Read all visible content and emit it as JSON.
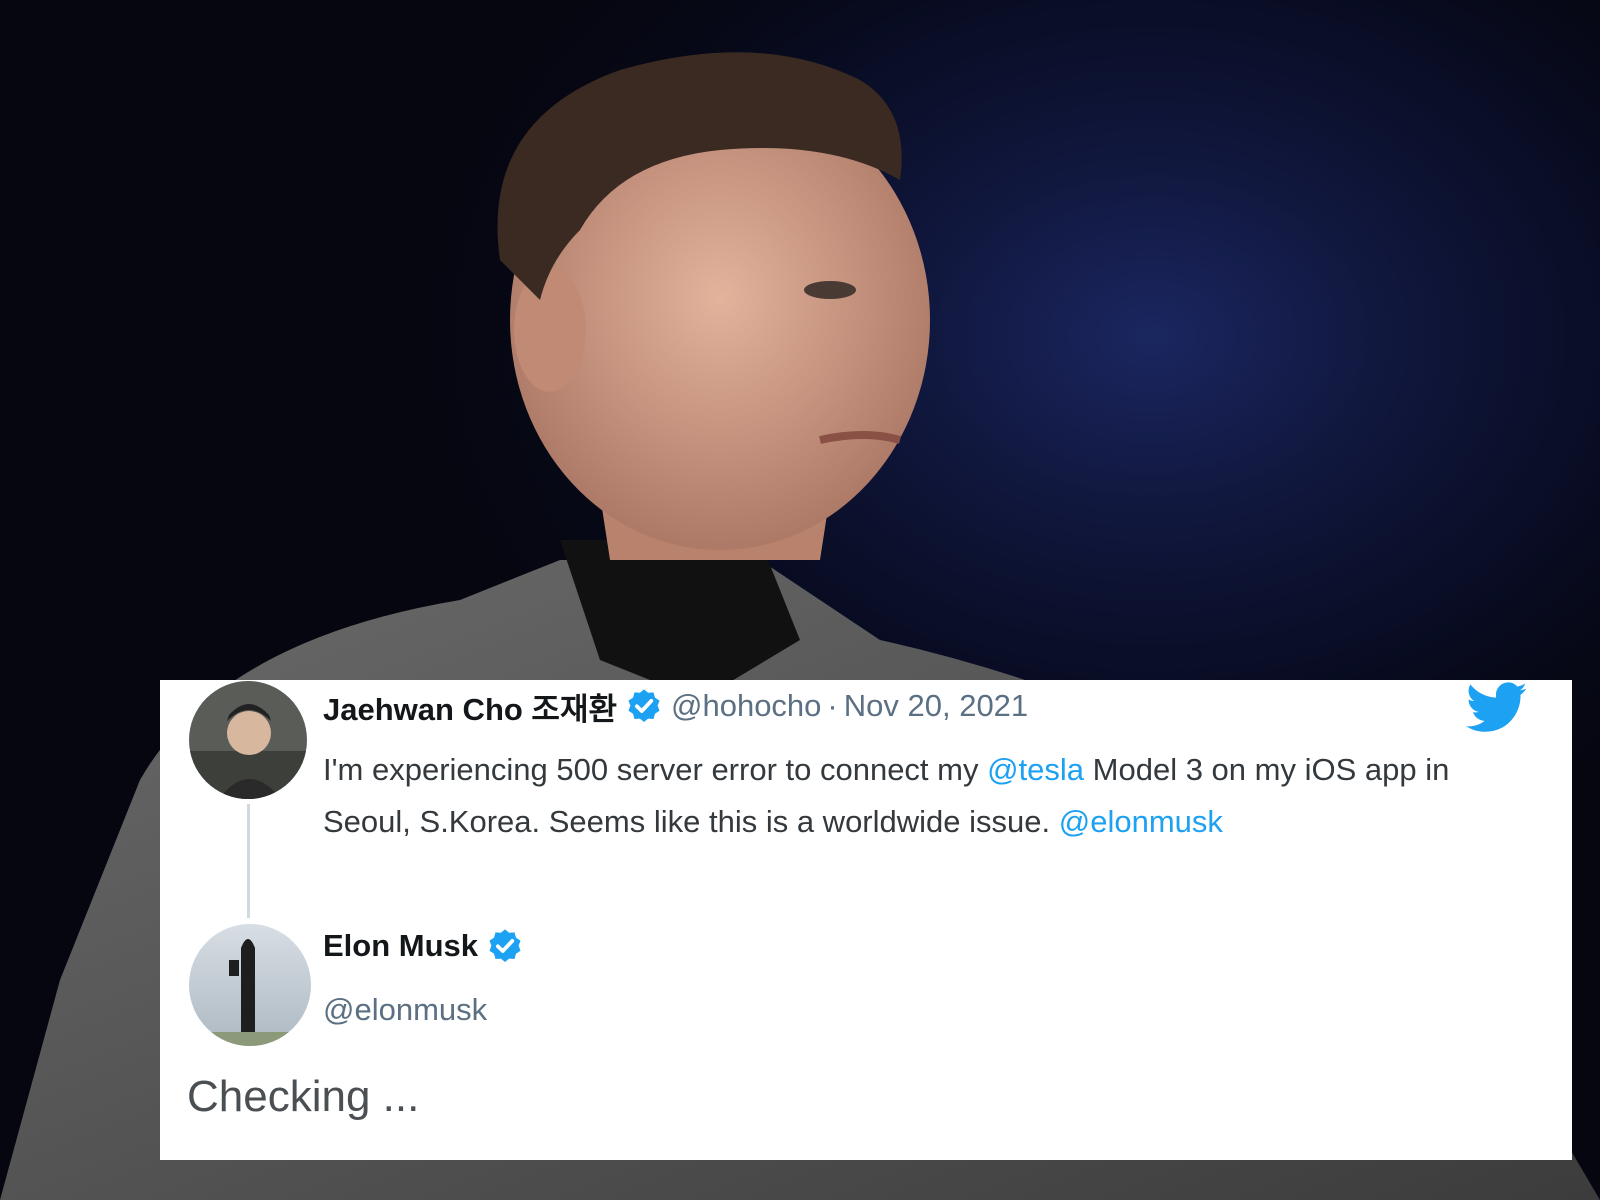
{
  "background_photo": {
    "subject": "portrait-photo",
    "colors": {
      "backdrop": "#05060f",
      "glow": "#1a2a6c",
      "jacket": "#5a5a5a"
    }
  },
  "tweet_card": {
    "brand_icon": "twitter-bird-icon",
    "brand_color": "#1da1f2",
    "original": {
      "display_name": "Jaehwan Cho 조재환",
      "verified_icon": "verified-badge-icon",
      "handle": "@hohocho",
      "separator": "·",
      "date": "Nov 20, 2021",
      "text_segments": [
        {
          "text": "I'm experiencing 500 server error to connect my ",
          "mention": false
        },
        {
          "text": "@tesla",
          "mention": true
        },
        {
          "text": " Model 3 on my iOS app in Seoul, S.Korea. Seems like this is a worldwide issue. ",
          "mention": false
        },
        {
          "text": "@elonmusk",
          "mention": true
        }
      ]
    },
    "reply": {
      "display_name": "Elon Musk",
      "verified_icon": "verified-badge-icon",
      "handle": "@elonmusk",
      "text": "Checking ..."
    }
  }
}
